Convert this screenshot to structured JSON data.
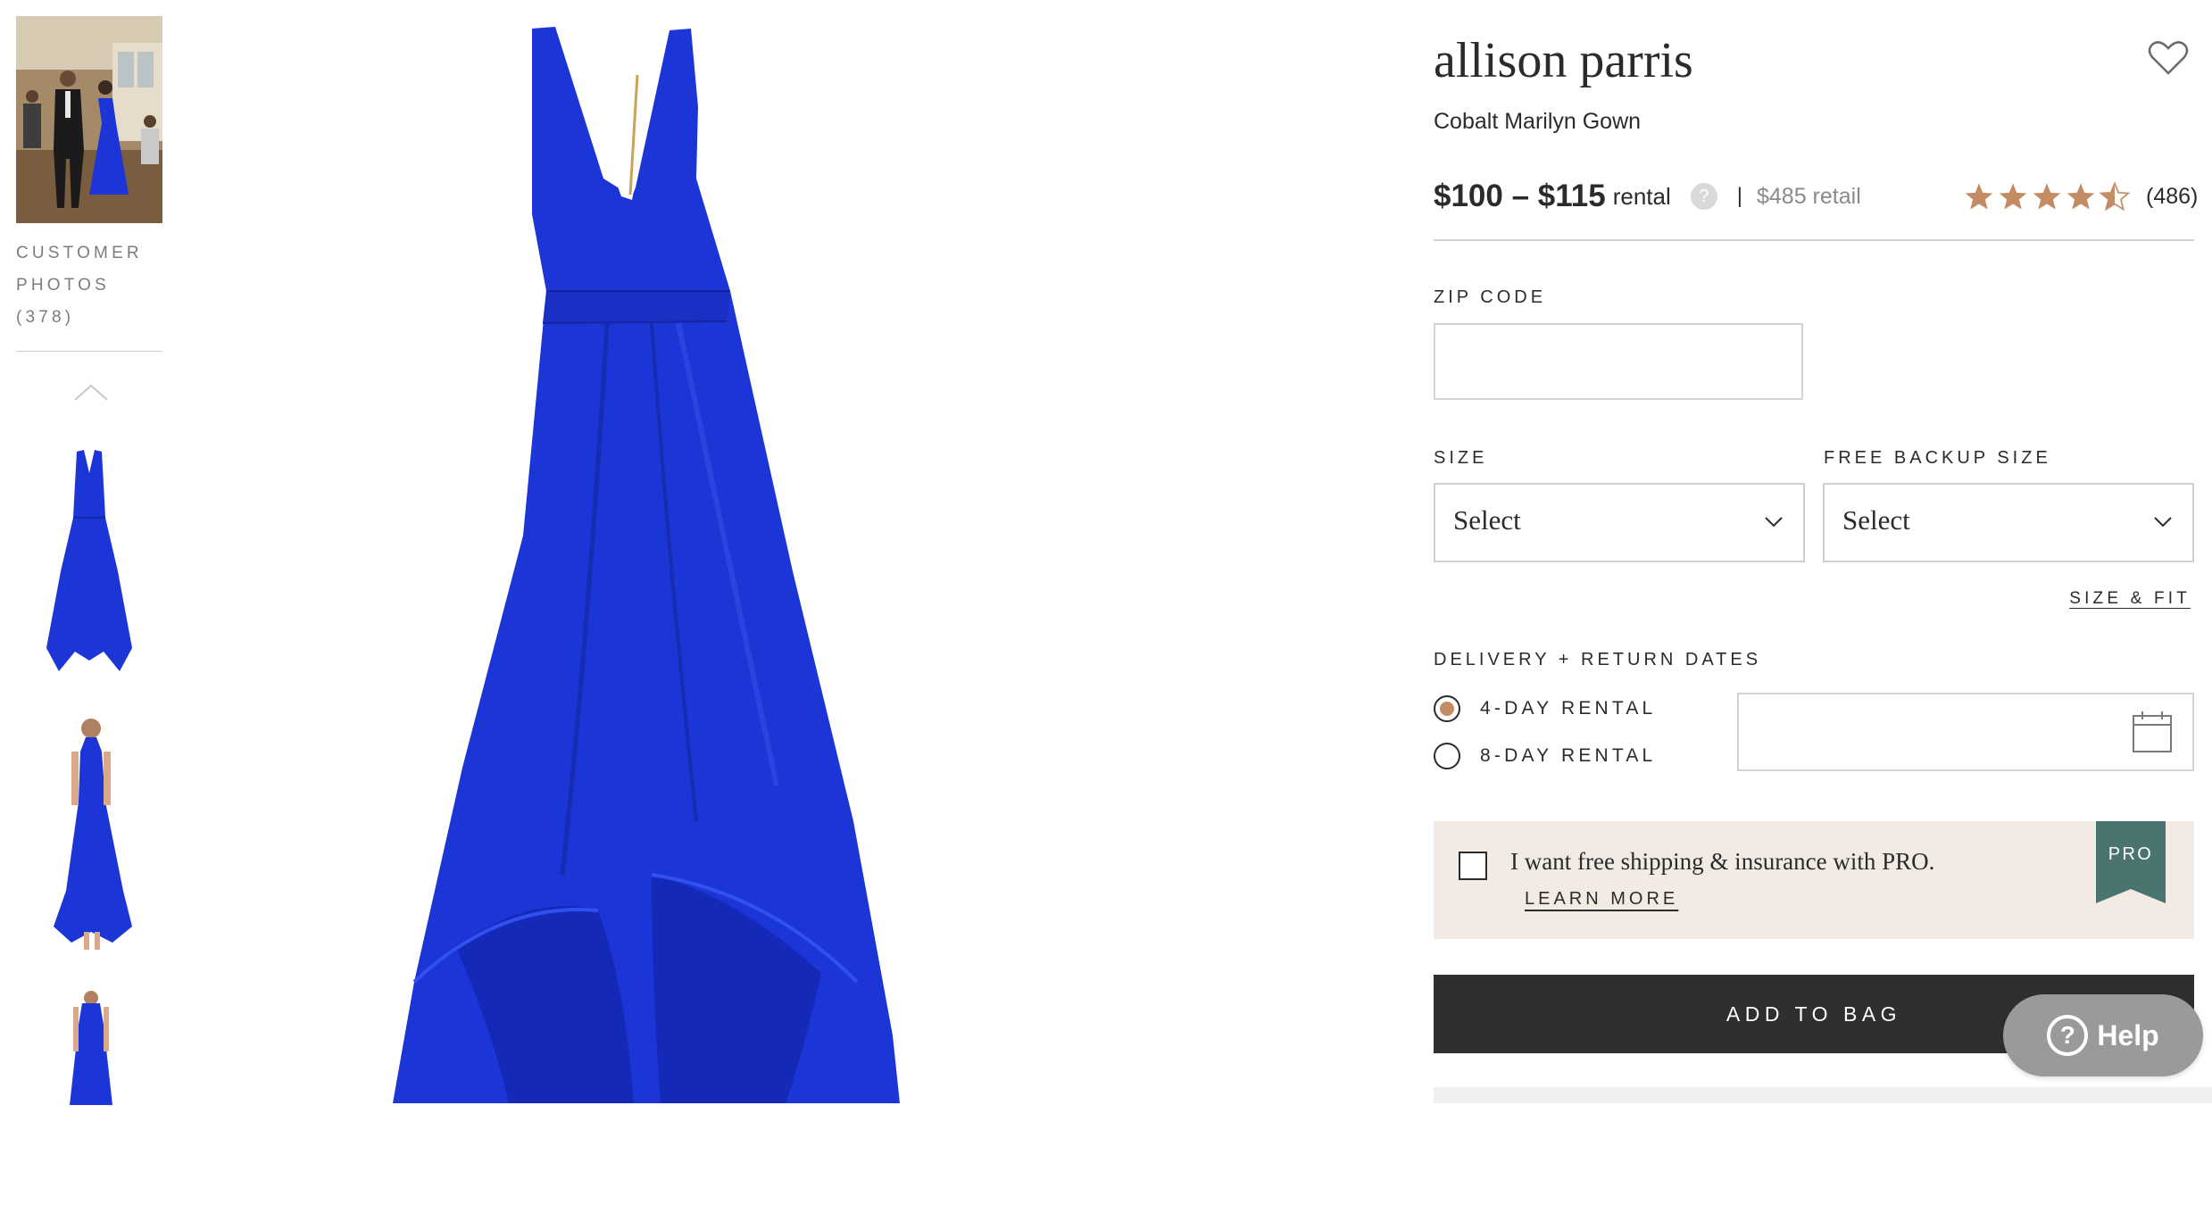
{
  "rail": {
    "customer_photos_label": "CUSTOMER",
    "customer_photos_label2": "PHOTOS",
    "customer_photos_count": "(378)"
  },
  "product": {
    "brand": "allison parris",
    "name": "Cobalt Marilyn Gown",
    "price_range": "$100 – $115",
    "price_suffix": "rental",
    "separator": "|",
    "retail": "$485 retail",
    "rating": 4.5,
    "reviews": "(486)",
    "dress_color": "#1c35d6"
  },
  "form": {
    "zip_label": "ZIP CODE",
    "zip_value": "",
    "size_label": "SIZE",
    "size_value": "Select",
    "backup_label": "FREE BACKUP SIZE",
    "backup_value": "Select",
    "size_fit_link": "SIZE & FIT",
    "delivery_label": "DELIVERY + RETURN DATES",
    "rental_options": [
      "4-DAY RENTAL",
      "8-DAY RENTAL"
    ],
    "selected_rental": "4-DAY RENTAL"
  },
  "pro": {
    "text": "I want free shipping & insurance with PRO.",
    "learn_more": "LEARN MORE",
    "badge": "PRO",
    "badge_color": "#4a7470"
  },
  "actions": {
    "add_to_bag": "ADD TO BAG",
    "help": "Help"
  },
  "colors": {
    "accent": "#c48c64",
    "button": "#2f2f2f",
    "pro_bg": "#f2ebe4"
  }
}
